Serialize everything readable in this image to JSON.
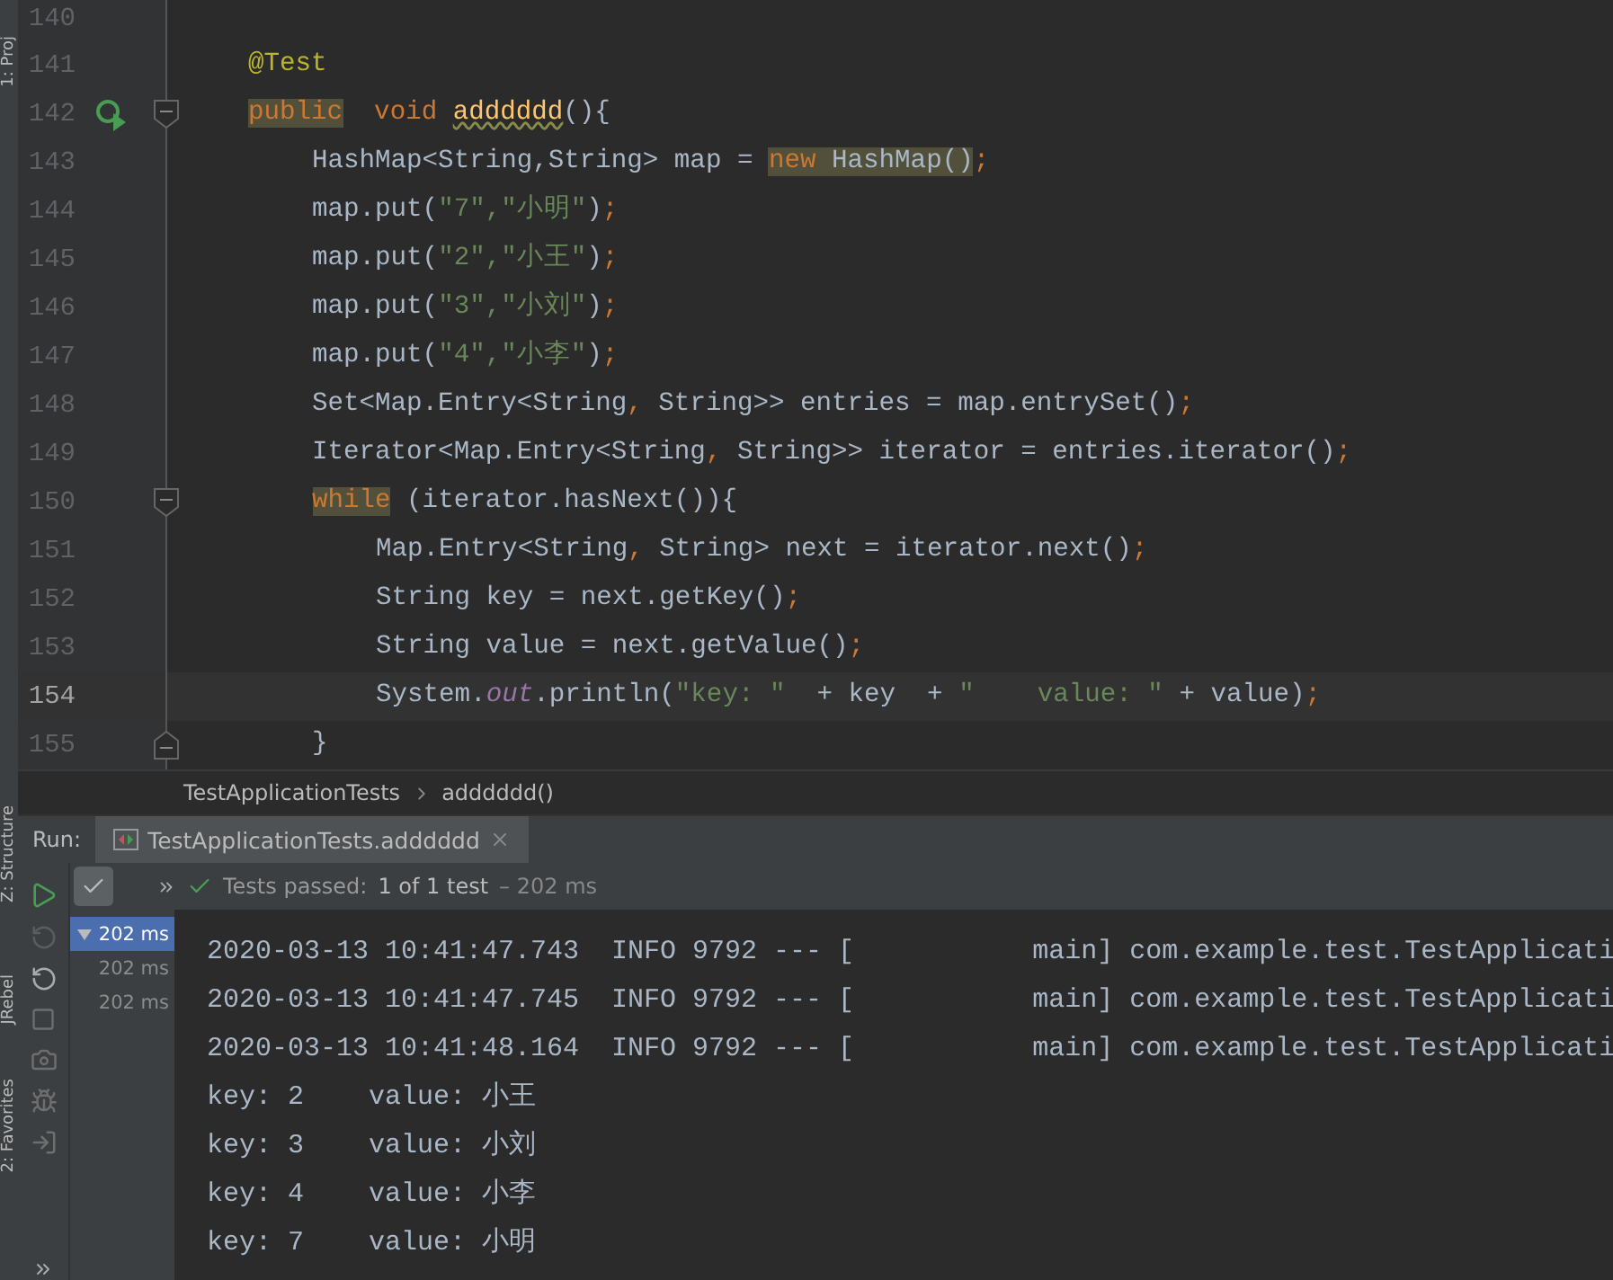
{
  "tool_window_strip": [
    "1: Proj",
    "Z: Structure",
    "JRebel",
    "2: Favorites"
  ],
  "editor": {
    "lines": [
      {
        "number": "140",
        "current": false
      },
      {
        "number": "141",
        "current": false,
        "tokens": [
          {
            "text": "@Test",
            "kind": "annotation"
          }
        ]
      },
      {
        "number": "142",
        "current": false,
        "run_marker": true,
        "fold_start": true,
        "tokens": [
          {
            "text": "public",
            "kind": "keyword",
            "highlighted": true
          },
          {
            "text": "  void ",
            "kind": "keyword"
          },
          {
            "text": "adddddd",
            "kind": "method",
            "warning": true
          },
          {
            "text": "(){",
            "kind": "plain"
          }
        ],
        "children": [
          {
            "number": "143",
            "current": false,
            "tokens": [
              {
                "text": "HashMap<String,String> map = ",
                "kind": "plain"
              },
              {
                "text": "new",
                "kind": "keyword",
                "highlighted": true
              },
              {
                "text": " HashMap()",
                "kind": "plain",
                "highlighted": true
              },
              {
                "text": ";",
                "kind": "keyword"
              }
            ]
          },
          {
            "number": "144",
            "current": false,
            "tokens": [
              {
                "text": "map.put(",
                "kind": "plain"
              },
              {
                "text": "\"7\",\"小明\"",
                "kind": "string"
              },
              {
                "text": ")",
                "kind": "plain"
              },
              {
                "text": ";",
                "kind": "keyword"
              }
            ]
          },
          {
            "number": "145",
            "current": false,
            "tokens": [
              {
                "text": "map.put(",
                "kind": "plain"
              },
              {
                "text": "\"2\",\"小王\"",
                "kind": "string"
              },
              {
                "text": ")",
                "kind": "plain"
              },
              {
                "text": ";",
                "kind": "keyword"
              }
            ]
          },
          {
            "number": "146",
            "current": false,
            "tokens": [
              {
                "text": "map.put(",
                "kind": "plain"
              },
              {
                "text": "\"3\",\"小刘\"",
                "kind": "string"
              },
              {
                "text": ")",
                "kind": "plain"
              },
              {
                "text": ";",
                "kind": "keyword"
              }
            ]
          },
          {
            "number": "147",
            "current": false,
            "tokens": [
              {
                "text": "map.put(",
                "kind": "plain"
              },
              {
                "text": "\"4\",\"小李\"",
                "kind": "string"
              },
              {
                "text": ")",
                "kind": "plain"
              },
              {
                "text": ";",
                "kind": "keyword"
              }
            ]
          },
          {
            "number": "148",
            "current": false,
            "tokens": [
              {
                "text": "Set<Map.Entry<String",
                "kind": "plain"
              },
              {
                "text": ",",
                "kind": "keyword"
              },
              {
                "text": " String>> entries = map.entrySet()",
                "kind": "plain"
              },
              {
                "text": ";",
                "kind": "keyword"
              }
            ]
          },
          {
            "number": "149",
            "current": false,
            "tokens": [
              {
                "text": "Iterator<Map.Entry<String",
                "kind": "plain"
              },
              {
                "text": ",",
                "kind": "keyword"
              },
              {
                "text": " String>> iterator = entries.iterator()",
                "kind": "plain"
              },
              {
                "text": ";",
                "kind": "keyword"
              }
            ]
          },
          {
            "number": "150",
            "current": false,
            "fold_start": true,
            "tokens": [
              {
                "text": "while",
                "kind": "keyword",
                "highlighted": true
              },
              {
                "text": " (iterator.hasNext()){",
                "kind": "plain"
              }
            ],
            "children": [
              {
                "number": "151",
                "current": false,
                "tokens": [
                  {
                    "text": "Map.Entry<String",
                    "kind": "plain"
                  },
                  {
                    "text": ",",
                    "kind": "keyword"
                  },
                  {
                    "text": " String> next = iterator.next()",
                    "kind": "plain"
                  },
                  {
                    "text": ";",
                    "kind": "keyword"
                  }
                ]
              },
              {
                "number": "152",
                "current": false,
                "tokens": [
                  {
                    "text": "String key = next.getKey()",
                    "kind": "plain"
                  },
                  {
                    "text": ";",
                    "kind": "keyword"
                  }
                ]
              },
              {
                "number": "153",
                "current": false,
                "tokens": [
                  {
                    "text": "String value = next.getValue()",
                    "kind": "plain"
                  },
                  {
                    "text": ";",
                    "kind": "keyword"
                  }
                ]
              },
              {
                "number": "154",
                "current": true,
                "tokens": [
                  {
                    "text": "System.",
                    "kind": "plain"
                  },
                  {
                    "text": "out",
                    "kind": "field"
                  },
                  {
                    "text": ".println(",
                    "kind": "plain"
                  },
                  {
                    "text": "\"key: \"",
                    "kind": "string"
                  },
                  {
                    "text": "  + key  + ",
                    "kind": "plain"
                  },
                  {
                    "text": "\"    value: \"",
                    "kind": "string"
                  },
                  {
                    "text": " + value)",
                    "kind": "plain"
                  },
                  {
                    "text": ";",
                    "kind": "keyword"
                  }
                ]
              }
            ]
          },
          {
            "number": "155",
            "current": false,
            "fold_end": true,
            "tokens": [
              {
                "text": "}",
                "kind": "plain"
              }
            ]
          }
        ]
      }
    ]
  },
  "breadcrumbs": [
    "TestApplicationTests",
    "adddddd()"
  ],
  "run_panel": {
    "label": "Run:",
    "tab": {
      "title": "TestApplicationTests.adddddd",
      "selected": true
    },
    "show_passed_pressed": true,
    "status": {
      "label": "Tests passed:",
      "count": "1 of 1 test",
      "duration": "– 202 ms"
    },
    "test_tree": [
      {
        "label": "202 ms",
        "selected": true,
        "expanded": true,
        "children": [
          {
            "label": "202 ms",
            "selected": false
          },
          {
            "label": "202 ms",
            "selected": false
          }
        ]
      }
    ],
    "console": [
      "2020-03-13 10:41:47.743  INFO 9792 --- [           main] com.example.test.TestApplicati",
      "2020-03-13 10:41:47.745  INFO 9792 --- [           main] com.example.test.TestApplicati",
      "2020-03-13 10:41:48.164  INFO 9792 --- [           main] com.example.test.TestApplicati",
      "key: 2    value: 小王",
      "key: 3    value: 小刘",
      "key: 4    value: 小李",
      "key: 7    value: 小明"
    ]
  }
}
